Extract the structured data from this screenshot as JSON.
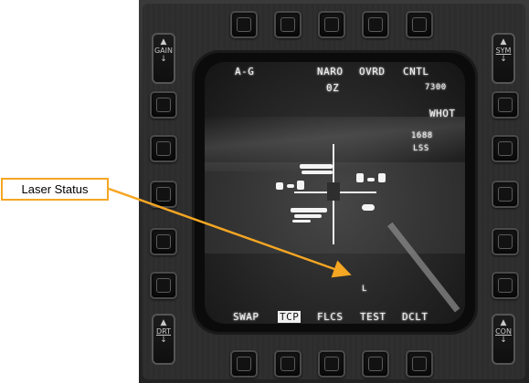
{
  "header": {
    "mode": "A-G",
    "naro": "NARO",
    "ovrd": "OVRD",
    "cntl": "CNTL",
    "zoom": "0Z",
    "altitude": "7300"
  },
  "right_status": {
    "polarity": "WHOT",
    "laser_code": "1688",
    "laser_mode": "LSS"
  },
  "laser_indicator": "L",
  "bottom_tabs": [
    "SWAP",
    "TCP",
    "FLCS",
    "TEST",
    "DCLT"
  ],
  "selected_tab": "TCP",
  "rockers": {
    "gain": "GAIN",
    "sym": "SYM",
    "drt": "DRT",
    "con": "CON"
  },
  "callout": {
    "label": "Laser Status",
    "color": "#f5a623"
  }
}
